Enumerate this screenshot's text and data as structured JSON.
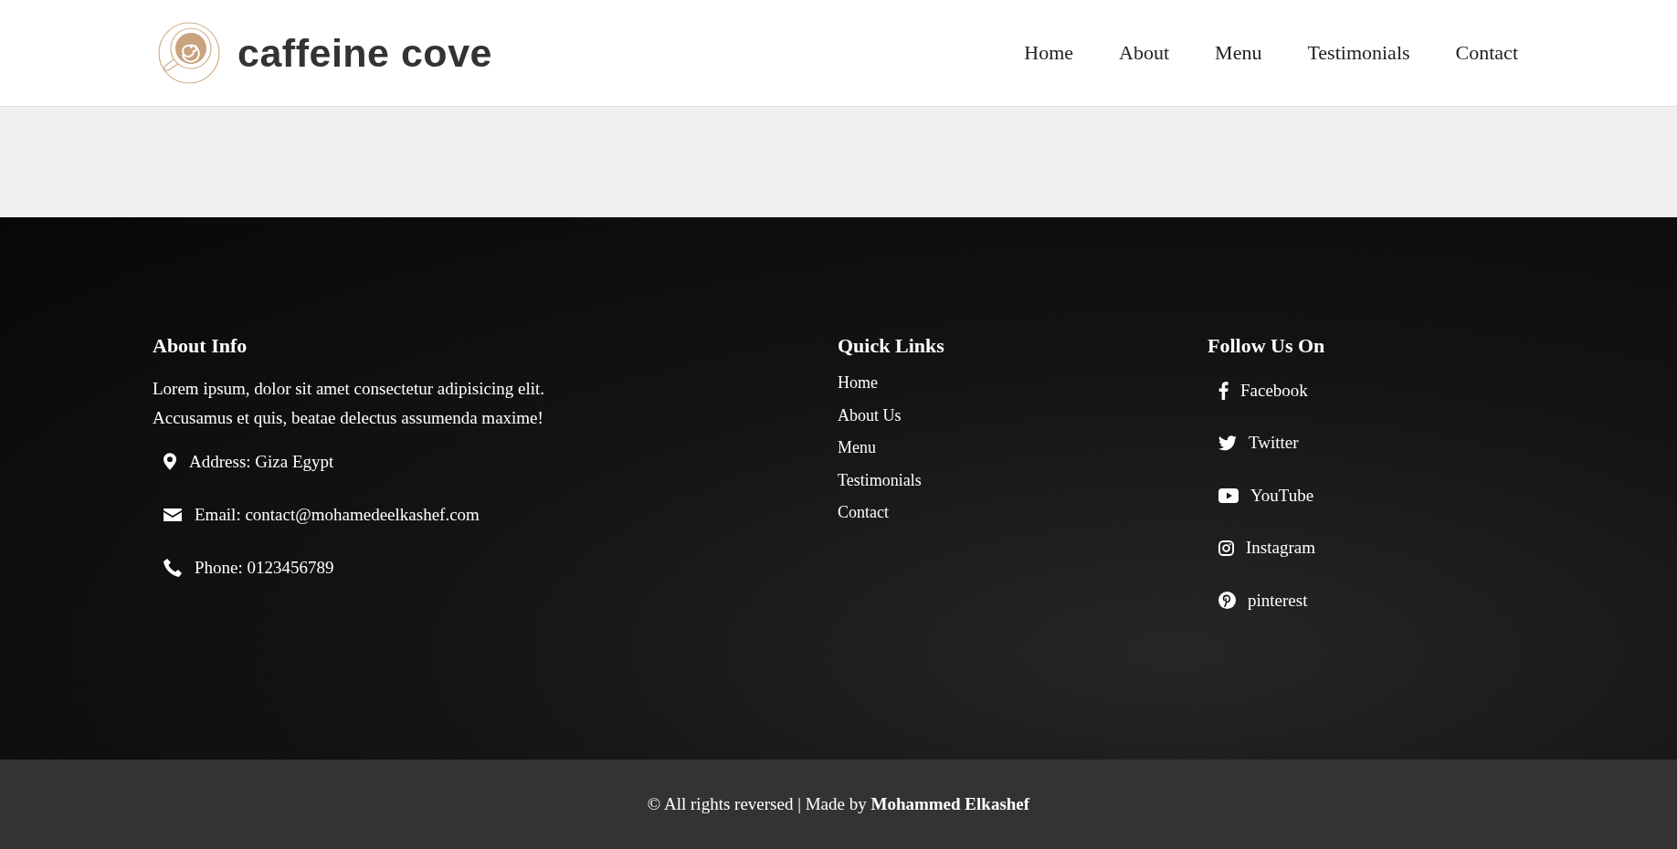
{
  "header": {
    "logo_text": "caffeine cove",
    "nav": [
      {
        "label": "Home"
      },
      {
        "label": "About"
      },
      {
        "label": "Menu"
      },
      {
        "label": "Testimonials"
      },
      {
        "label": "Contact"
      }
    ]
  },
  "footer": {
    "about": {
      "heading": "About Info",
      "text": "Lorem ipsum, dolor sit amet consectetur adipisicing elit. Accusamus et quis, beatae delectus assumenda maxime!",
      "contacts": [
        {
          "kind": "address",
          "text": "Address: Giza Egypt"
        },
        {
          "kind": "email",
          "text": "Email: contact@mohamedeelkashef.com"
        },
        {
          "kind": "phone",
          "text": "Phone: 0123456789"
        }
      ]
    },
    "quick_links": {
      "heading": "Quick Links",
      "links": [
        "Home",
        "About Us",
        "Menu",
        "Testimonials",
        "Contact"
      ]
    },
    "follow": {
      "heading": "Follow Us On",
      "links": [
        {
          "kind": "facebook",
          "label": "Facebook"
        },
        {
          "kind": "twitter",
          "label": "Twitter"
        },
        {
          "kind": "youtube",
          "label": "YouTube"
        },
        {
          "kind": "instagram",
          "label": "Instagram"
        },
        {
          "kind": "pinterest",
          "label": "pinterest"
        }
      ]
    }
  },
  "copyright": "© All rights reversed | Made by **Mohammed Elkashef**"
}
